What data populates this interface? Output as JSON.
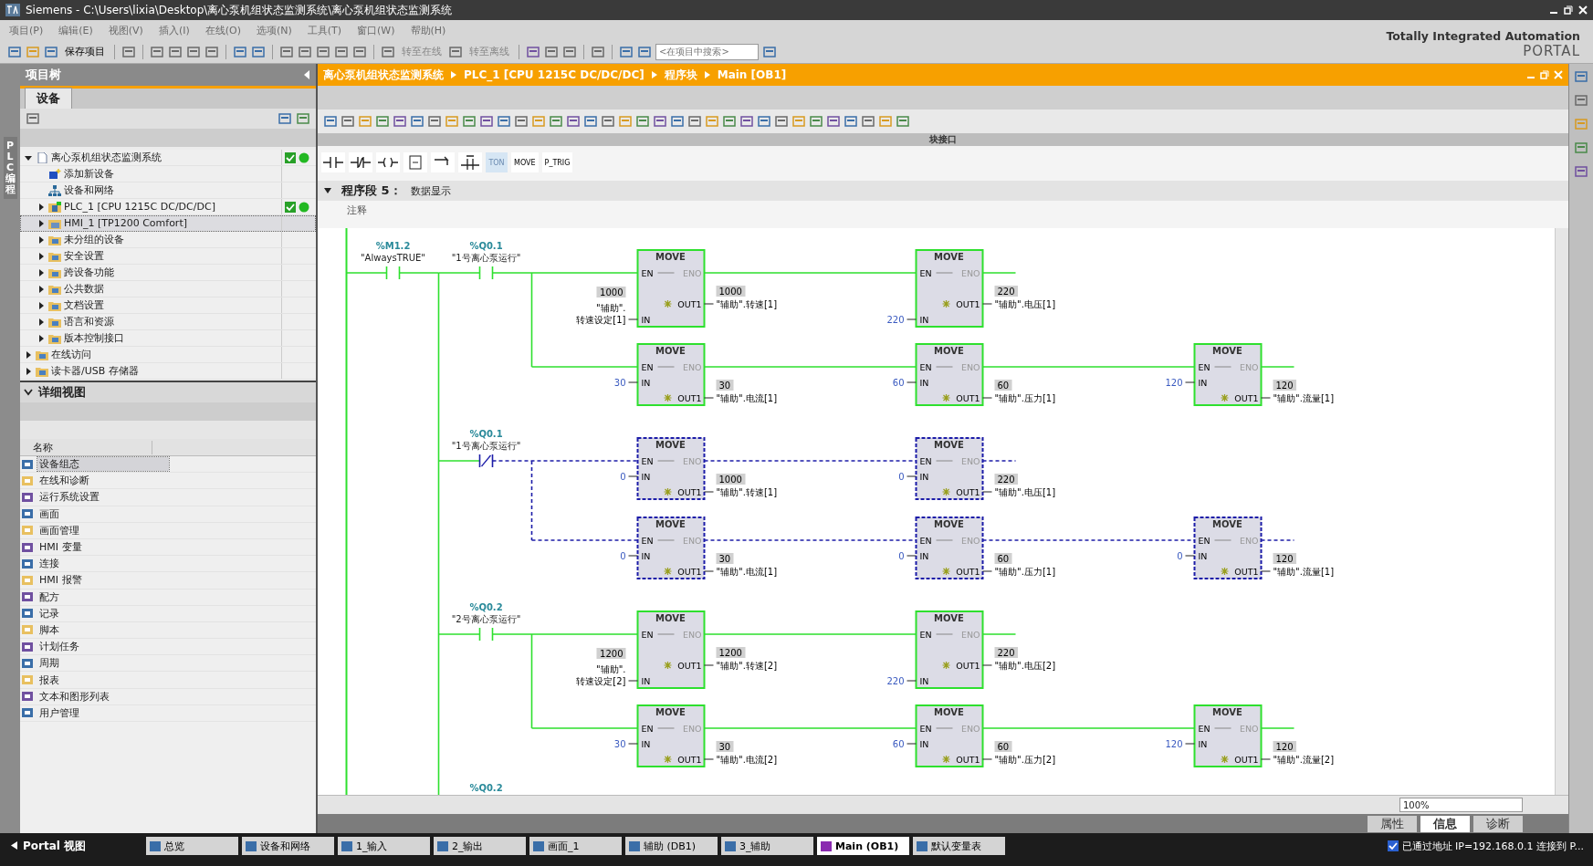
{
  "window": {
    "title": "Siemens  -  C:\\Users\\lixia\\Desktop\\离心泵机组状态监测系统\\离心泵机组状态监测系统"
  },
  "menu": [
    "项目(P)",
    "编辑(E)",
    "视图(V)",
    "插入(I)",
    "在线(O)",
    "选项(N)",
    "工具(T)",
    "窗口(W)",
    "帮助(H)"
  ],
  "toolbar": {
    "save": {
      "label": "保存项目",
      "disabled": false
    },
    "go_online": {
      "label": "转至在线",
      "disabled": true
    },
    "go_offline": {
      "label": "转至离线",
      "disabled": true
    },
    "search": {
      "placeholder": "<在项目中搜索>"
    }
  },
  "brand": {
    "line1": "Totally Integrated Automation",
    "line2": "PORTAL"
  },
  "side_tab": {
    "label": "PLC 编程"
  },
  "project_tree": {
    "title": "项目树",
    "tab": "设备",
    "items": [
      {
        "label": "离心泵机组状态监测系统",
        "kind": "project",
        "expanded": true,
        "status_ok": true,
        "selected": false,
        "children": [
          {
            "label": "添加新设备",
            "kind": "add",
            "status_ok": false,
            "selected": false
          },
          {
            "label": "设备和网络",
            "kind": "network",
            "status_ok": false,
            "selected": false
          },
          {
            "label": "PLC_1 [CPU 1215C DC/DC/DC]",
            "kind": "plc",
            "expanded": false,
            "status_ok": true,
            "selected": false
          },
          {
            "label": "HMI_1 [TP1200 Comfort]",
            "kind": "hmi",
            "expanded": false,
            "status_ok": false,
            "selected": true
          },
          {
            "label": "未分组的设备",
            "kind": "folder",
            "expanded": false,
            "status_ok": false,
            "selected": false
          },
          {
            "label": "安全设置",
            "kind": "folder",
            "expanded": false,
            "status_ok": false,
            "selected": false
          },
          {
            "label": "跨设备功能",
            "kind": "folder",
            "expanded": false,
            "status_ok": false,
            "selected": false
          },
          {
            "label": "公共数据",
            "kind": "folder",
            "expanded": false,
            "status_ok": false,
            "selected": false
          },
          {
            "label": "文档设置",
            "kind": "folder",
            "expanded": false,
            "status_ok": false,
            "selected": false
          },
          {
            "label": "语言和资源",
            "kind": "folder",
            "expanded": false,
            "status_ok": false,
            "selected": false
          },
          {
            "label": "版本控制接口",
            "kind": "folder",
            "expanded": false,
            "status_ok": false,
            "selected": false
          }
        ]
      },
      {
        "label": "在线访问",
        "kind": "folder",
        "expanded": false,
        "status_ok": false,
        "selected": false
      },
      {
        "label": "读卡器/USB 存储器",
        "kind": "folder",
        "expanded": false,
        "status_ok": false,
        "selected": false
      }
    ]
  },
  "detail_view": {
    "title": "详细视图",
    "expanded": true,
    "column": "名称",
    "items": [
      {
        "label": "设备组态",
        "selected": true
      },
      {
        "label": "在线和诊断",
        "selected": false
      },
      {
        "label": "运行系统设置",
        "selected": false
      },
      {
        "label": "画面",
        "selected": false
      },
      {
        "label": "画面管理",
        "selected": false
      },
      {
        "label": "HMI 变量",
        "selected": false
      },
      {
        "label": "连接",
        "selected": false
      },
      {
        "label": "HMI 报警",
        "selected": false
      },
      {
        "label": "配方",
        "selected": false
      },
      {
        "label": "记录",
        "selected": false
      },
      {
        "label": "脚本",
        "selected": false
      },
      {
        "label": "计划任务",
        "selected": false
      },
      {
        "label": "周期",
        "selected": false
      },
      {
        "label": "报表",
        "selected": false
      },
      {
        "label": "文本和图形列表",
        "selected": false
      },
      {
        "label": "用户管理",
        "selected": false
      }
    ]
  },
  "editor": {
    "breadcrumb": [
      "离心泵机组状态监测系统",
      "PLC_1 [CPU 1215C DC/DC/DC]",
      "程序块",
      "Main [OB1]"
    ],
    "interface_bar": "块接口",
    "instructions": [
      {
        "label": "TON",
        "selected": true
      },
      {
        "label": "MOVE",
        "selected": false
      },
      {
        "label": "P_TRIG",
        "selected": false
      }
    ],
    "network": {
      "title": "程序段 5：",
      "name": "数据显示",
      "expanded": true,
      "comment": "注释",
      "ladder": {
        "contact": {
          "address": "%M1.2",
          "tag": "\"AlwaysTRUE\"",
          "kind": "no"
        },
        "branches": [
          {
            "contact": {
              "address": "%Q0.1",
              "tag": "\"1号离心泵运行\"",
              "kind": "no"
            },
            "powered": true,
            "rows": [
              [
                {
                  "title": "MOVE",
                  "en": "EN",
                  "eno": "ENO",
                  "in": "IN",
                  "out": "OUT1",
                  "in_value": "1000",
                  "in_lines": [
                    "\"辅助\".",
                    "转速设定[1]"
                  ],
                  "out_value": "1000",
                  "out_operand": "\"辅助\".转速[1]"
                },
                {
                  "title": "MOVE",
                  "en": "EN",
                  "eno": "ENO",
                  "in": "IN",
                  "out": "OUT1",
                  "in_lines": [
                    "220"
                  ],
                  "out_value": "220",
                  "out_operand": "\"辅助\".电压[1]"
                }
              ],
              [
                {
                  "title": "MOVE",
                  "en": "EN",
                  "eno": "ENO",
                  "in": "IN",
                  "out": "OUT1",
                  "in_lines": [
                    "30"
                  ],
                  "out_value": "30",
                  "out_operand": "\"辅助\".电流[1]"
                },
                {
                  "title": "MOVE",
                  "en": "EN",
                  "eno": "ENO",
                  "in": "IN",
                  "out": "OUT1",
                  "in_lines": [
                    "60"
                  ],
                  "out_value": "60",
                  "out_operand": "\"辅助\".压力[1]"
                },
                {
                  "title": "MOVE",
                  "en": "EN",
                  "eno": "ENO",
                  "in": "IN",
                  "out": "OUT1",
                  "in_lines": [
                    "120"
                  ],
                  "out_value": "120",
                  "out_operand": "\"辅助\".流量[1]"
                }
              ]
            ]
          },
          {
            "contact": {
              "address": "%Q0.1",
              "tag": "\"1号离心泵运行\"",
              "kind": "nc"
            },
            "powered": false,
            "rows": [
              [
                {
                  "title": "MOVE",
                  "en": "EN",
                  "eno": "ENO",
                  "in": "IN",
                  "out": "OUT1",
                  "in_lines": [
                    "0"
                  ],
                  "out_value": "1000",
                  "out_operand": "\"辅助\".转速[1]"
                },
                {
                  "title": "MOVE",
                  "en": "EN",
                  "eno": "ENO",
                  "in": "IN",
                  "out": "OUT1",
                  "in_lines": [
                    "0"
                  ],
                  "out_value": "220",
                  "out_operand": "\"辅助\".电压[1]"
                }
              ],
              [
                {
                  "title": "MOVE",
                  "en": "EN",
                  "eno": "ENO",
                  "in": "IN",
                  "out": "OUT1",
                  "in_lines": [
                    "0"
                  ],
                  "out_value": "30",
                  "out_operand": "\"辅助\".电流[1]"
                },
                {
                  "title": "MOVE",
                  "en": "EN",
                  "eno": "ENO",
                  "in": "IN",
                  "out": "OUT1",
                  "in_lines": [
                    "0"
                  ],
                  "out_value": "60",
                  "out_operand": "\"辅助\".压力[1]"
                },
                {
                  "title": "MOVE",
                  "en": "EN",
                  "eno": "ENO",
                  "in": "IN",
                  "out": "OUT1",
                  "in_lines": [
                    "0"
                  ],
                  "out_value": "120",
                  "out_operand": "\"辅助\".流量[1]"
                }
              ]
            ]
          },
          {
            "contact": {
              "address": "%Q0.2",
              "tag": "\"2号离心泵运行\"",
              "kind": "no"
            },
            "powered": true,
            "rows": [
              [
                {
                  "title": "MOVE",
                  "en": "EN",
                  "eno": "ENO",
                  "in": "IN",
                  "out": "OUT1",
                  "in_value": "1200",
                  "in_lines": [
                    "\"辅助\".",
                    "转速设定[2]"
                  ],
                  "out_value": "1200",
                  "out_operand": "\"辅助\".转速[2]"
                },
                {
                  "title": "MOVE",
                  "en": "EN",
                  "eno": "ENO",
                  "in": "IN",
                  "out": "OUT1",
                  "in_lines": [
                    "220"
                  ],
                  "out_value": "220",
                  "out_operand": "\"辅助\".电压[2]"
                }
              ],
              [
                {
                  "title": "MOVE",
                  "en": "EN",
                  "eno": "ENO",
                  "in": "IN",
                  "out": "OUT1",
                  "in_lines": [
                    "30"
                  ],
                  "out_value": "30",
                  "out_operand": "\"辅助\".电流[2]"
                },
                {
                  "title": "MOVE",
                  "en": "EN",
                  "eno": "ENO",
                  "in": "IN",
                  "out": "OUT1",
                  "in_lines": [
                    "60"
                  ],
                  "out_value": "60",
                  "out_operand": "\"辅助\".压力[2]"
                },
                {
                  "title": "MOVE",
                  "en": "EN",
                  "eno": "ENO",
                  "in": "IN",
                  "out": "OUT1",
                  "in_lines": [
                    "120"
                  ],
                  "out_value": "120",
                  "out_operand": "\"辅助\".流量[2]"
                }
              ]
            ]
          }
        ],
        "next_address": "%Q0.2"
      }
    },
    "zoom": "100%"
  },
  "inspector_tabs": [
    {
      "label": "属性",
      "selected": false
    },
    {
      "label": "信息",
      "selected": true
    },
    {
      "label": "诊断",
      "selected": false
    }
  ],
  "taskbar": {
    "portal": "Portal 视图",
    "tabs": [
      {
        "label": "总览",
        "selected": false
      },
      {
        "label": "设备和网络",
        "selected": false
      },
      {
        "label": "1_输入",
        "selected": false
      },
      {
        "label": "2_输出",
        "selected": false
      },
      {
        "label": "画面_1",
        "selected": false
      },
      {
        "label": "辅助 (DB1)",
        "selected": false
      },
      {
        "label": "3_辅助",
        "selected": false
      },
      {
        "label": "Main (OB1)",
        "selected": true
      },
      {
        "label": "默认变量表",
        "selected": false
      }
    ],
    "status": "已通过地址 IP=192.168.0.1 连接到 P..."
  }
}
